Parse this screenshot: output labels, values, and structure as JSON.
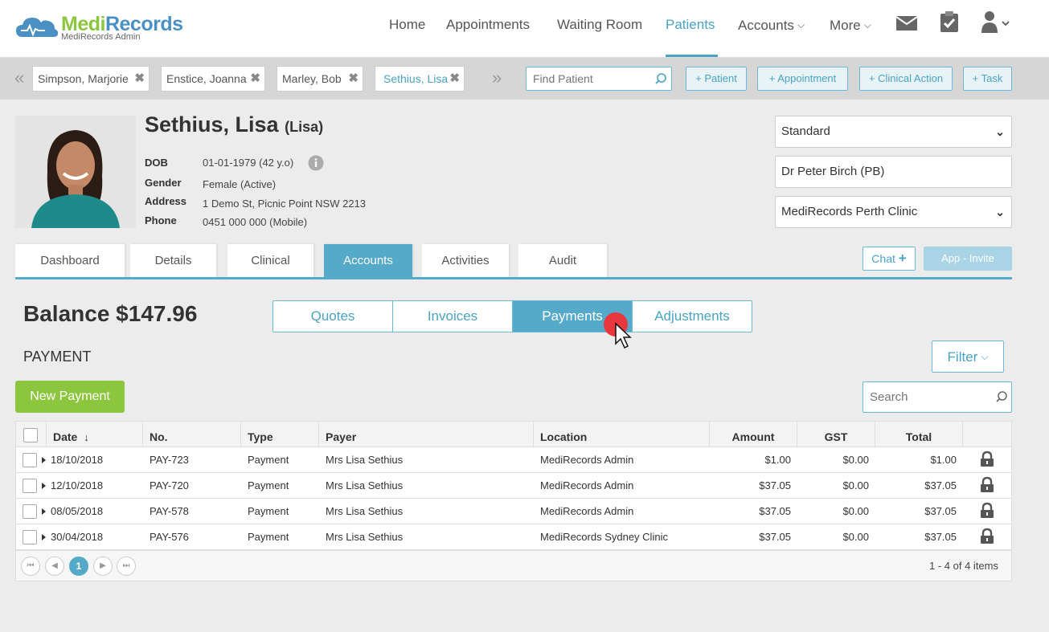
{
  "app": {
    "brand_part1": "Medi",
    "brand_part2": "Records",
    "subtitle": "MediRecords Admin"
  },
  "nav": {
    "items": [
      {
        "label": "Home"
      },
      {
        "label": "Appointments"
      },
      {
        "label": "Waiting Room"
      },
      {
        "label": "Patients",
        "active": true
      },
      {
        "label": "Accounts"
      },
      {
        "label": "More"
      }
    ],
    "icons": [
      "mail-icon",
      "clipboard-check-icon",
      "user-icon"
    ]
  },
  "patient_tabs": [
    {
      "label": "Simpson, Marjorie"
    },
    {
      "label": "Enstice, Joanna"
    },
    {
      "label": "Marley, Bob"
    },
    {
      "label": "Sethius, Lisa",
      "active": true
    }
  ],
  "find_patient": {
    "placeholder": "Find Patient"
  },
  "quick_actions": [
    "+ Patient",
    "+ Appointment",
    "+ Clinical Action",
    "+ Task"
  ],
  "patient": {
    "name": "Sethius, Lisa",
    "preferred": "(Lisa)",
    "fields": [
      {
        "label": "DOB",
        "value": "01-01-1979 (42 y.o)"
      },
      {
        "label": "Gender",
        "value": "Female (Active)"
      },
      {
        "label": "Address",
        "value": "1 Demo St, Picnic Point NSW 2213"
      },
      {
        "label": "Phone",
        "value": "0451 000 000 (Mobile)"
      }
    ]
  },
  "selectors": {
    "billing": "Standard",
    "practitioner": "Dr Peter Birch (PB)",
    "clinic": "MediRecords Perth Clinic"
  },
  "section_tabs": [
    "Dashboard",
    "Details",
    "Clinical",
    "Accounts",
    "Activities",
    "Audit"
  ],
  "section_tab_active": "Accounts",
  "chat_label": "Chat",
  "invite_label": "App - Invite",
  "balance": "Balance $147.96",
  "segments": [
    "Quotes",
    "Invoices",
    "Payments",
    "Adjustments"
  ],
  "segment_active": "Payments",
  "section_title": "PAYMENT",
  "filter_label": "Filter",
  "new_payment_label": "New Payment",
  "search": {
    "placeholder": "Search"
  },
  "table": {
    "columns": [
      "Date",
      "No.",
      "Type",
      "Payer",
      "Location",
      "Amount",
      "GST",
      "Total"
    ],
    "rows": [
      {
        "date": "18/10/2018",
        "no": "PAY-723",
        "type": "Payment",
        "payer": "Mrs Lisa Sethius",
        "location": "MediRecords Admin",
        "amount": "$1.00",
        "gst": "$0.00",
        "total": "$1.00"
      },
      {
        "date": "12/10/2018",
        "no": "PAY-720",
        "type": "Payment",
        "payer": "Mrs Lisa Sethius",
        "location": "MediRecords Admin",
        "amount": "$37.05",
        "gst": "$0.00",
        "total": "$37.05"
      },
      {
        "date": "08/05/2018",
        "no": "PAY-578",
        "type": "Payment",
        "payer": "Mrs Lisa Sethius",
        "location": "MediRecords Admin",
        "amount": "$37.05",
        "gst": "$0.00",
        "total": "$37.05"
      },
      {
        "date": "30/04/2018",
        "no": "PAY-576",
        "type": "Payment",
        "payer": "Mrs Lisa Sethius",
        "location": "MediRecords Sydney Clinic",
        "amount": "$37.05",
        "gst": "$0.00",
        "total": "$37.05"
      }
    ]
  },
  "pager": {
    "current_page": "1",
    "summary": "1 - 4 of 4 items"
  },
  "colors": {
    "accent": "#55a9c9",
    "green": "#8cc63f",
    "cursor_dot": "#e8383d"
  }
}
